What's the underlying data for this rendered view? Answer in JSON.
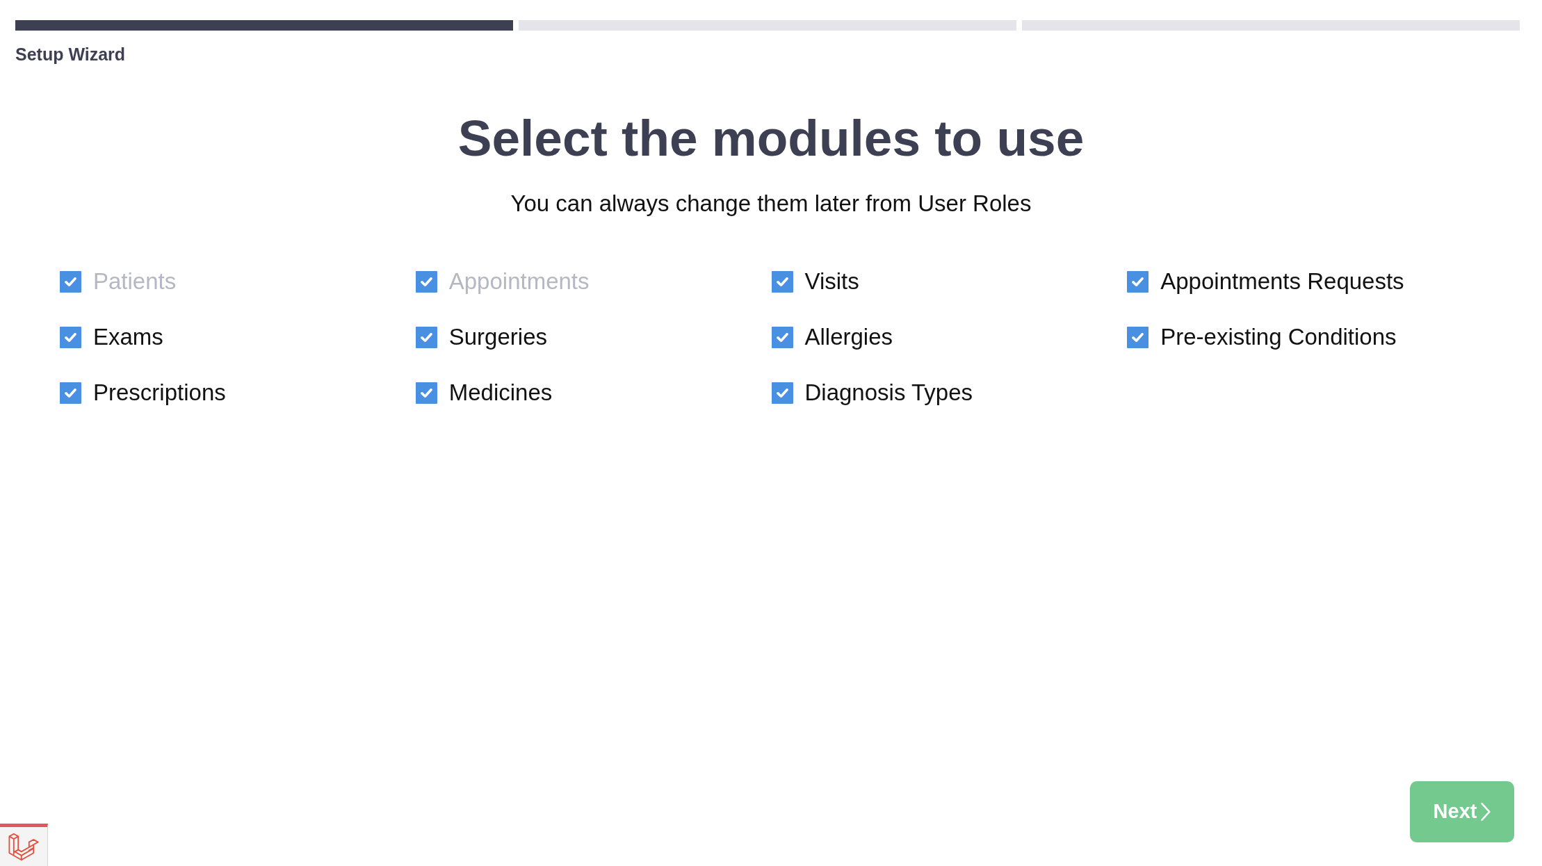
{
  "steps": [
    {
      "completed": true
    },
    {
      "completed": false
    },
    {
      "completed": false
    }
  ],
  "wizard_label": "Setup Wizard",
  "heading": "Select the modules to use",
  "subheading": "You can always change them later from User Roles",
  "modules": [
    {
      "label": "Patients",
      "checked": true,
      "disabled": true
    },
    {
      "label": "Appointments",
      "checked": true,
      "disabled": true
    },
    {
      "label": "Visits",
      "checked": true,
      "disabled": false
    },
    {
      "label": "Appointments Requests",
      "checked": true,
      "disabled": false
    },
    {
      "label": "Exams",
      "checked": true,
      "disabled": false
    },
    {
      "label": "Surgeries",
      "checked": true,
      "disabled": false
    },
    {
      "label": "Allergies",
      "checked": true,
      "disabled": false
    },
    {
      "label": "Pre-existing Conditions",
      "checked": true,
      "disabled": false
    },
    {
      "label": "Prescriptions",
      "checked": true,
      "disabled": false
    },
    {
      "label": "Medicines",
      "checked": true,
      "disabled": false
    },
    {
      "label": "Diagnosis Types",
      "checked": true,
      "disabled": false
    }
  ],
  "next_button": {
    "label": "Next"
  }
}
